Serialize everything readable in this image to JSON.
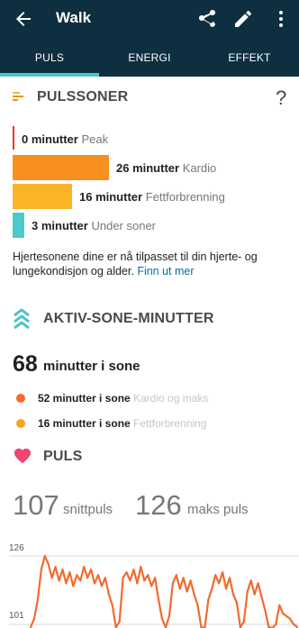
{
  "appbar": {
    "title": "Walk",
    "icons": [
      "back-arrow-icon",
      "share-icon",
      "edit-pencil-icon",
      "more-vert-icon"
    ]
  },
  "tabs": [
    {
      "label": "PULS",
      "active": true
    },
    {
      "label": "ENERGI",
      "active": false
    },
    {
      "label": "EFFEKT",
      "active": false
    }
  ],
  "pulssoner": {
    "title": "PULSSONER",
    "help": "?",
    "zones": [
      {
        "value": "0 minutter",
        "name": "Peak",
        "color": "#e53935"
      },
      {
        "value": "26 minutter",
        "name": "Kardio",
        "color": "#f7901e"
      },
      {
        "value": "16 minutter",
        "name": "Fettforbrenning",
        "color": "#fbb426"
      },
      {
        "value": "3 minutter",
        "name": "Under soner",
        "color": "#4ec9c9"
      }
    ],
    "text": "Hjertesonene dine er nå tilpasset til din hjerte- og lungekondisjon og alder.",
    "link": "Finn ut mer"
  },
  "aktiv": {
    "title": "AKTIV-SONE-MINUTTER",
    "total": "68",
    "total_label": "minutter i sone",
    "rows": [
      {
        "value": "52 minutter i sone",
        "label": "Kardio og maks",
        "color": "#f26b2f"
      },
      {
        "value": "16 minutter i sone",
        "label": "Fettforbrenning",
        "color": "#f5a623"
      }
    ]
  },
  "puls": {
    "title": "PULS",
    "avg": "107",
    "avg_label": "snittpuls",
    "max": "126",
    "max_label": "maks puls",
    "colors": {
      "line": "#f26b2f",
      "heart": "#ef476f",
      "accent": "#4fc3c6"
    }
  },
  "chart_data": {
    "type": "line",
    "yticks": [
      "126",
      "101"
    ],
    "ylim": [
      101,
      126
    ],
    "x": [
      0,
      1,
      2,
      3,
      4,
      5,
      6,
      7,
      8,
      9,
      10,
      11,
      12,
      13,
      14,
      15,
      16,
      17,
      18,
      19,
      20,
      21,
      22,
      23,
      24,
      25,
      26,
      27,
      28,
      29,
      30,
      31,
      32,
      33,
      34,
      35,
      36,
      37,
      38,
      39,
      40,
      41,
      42,
      43,
      44,
      45,
      46,
      47,
      48,
      49,
      50,
      51,
      52,
      53,
      54,
      55,
      56,
      57,
      58,
      59,
      60,
      61,
      62,
      63,
      64,
      65,
      66,
      67,
      68,
      69,
      70,
      71,
      72,
      73,
      74,
      75
    ],
    "series": [
      {
        "values": [
          100,
          103,
          110,
          121,
          126,
          123,
          118,
          122,
          117,
          121,
          116,
          120,
          115,
          119,
          117,
          122,
          118,
          121,
          116,
          119,
          115,
          118,
          112,
          108,
          100,
          102,
          118,
          120,
          117,
          121,
          116,
          122,
          117,
          119,
          115,
          118,
          110,
          103,
          100,
          104,
          116,
          119,
          114,
          118,
          113,
          117,
          112,
          108,
          100,
          99,
          110,
          114,
          119,
          116,
          120,
          114,
          118,
          112,
          109,
          100,
          102,
          113,
          117,
          112,
          116,
          111,
          106,
          100,
          99,
          101,
          108,
          105,
          104,
          103,
          101,
          100
        ]
      }
    ]
  }
}
